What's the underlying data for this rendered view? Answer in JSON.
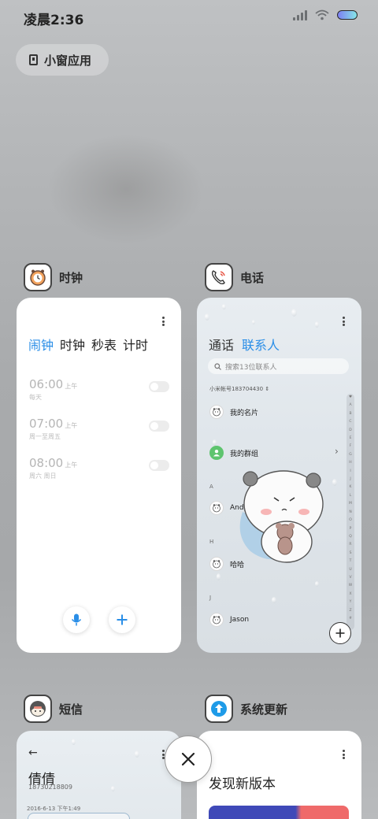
{
  "status_bar": {
    "time": "凌晨2:36"
  },
  "floating_windows": {
    "label": "小窗应用"
  },
  "apps": {
    "clock": {
      "name": "时钟",
      "tabs": [
        "闹钟",
        "时钟",
        "秒表",
        "计时"
      ],
      "alarms": [
        {
          "time": "06:00",
          "ampm": "上午",
          "days": "每天"
        },
        {
          "time": "07:00",
          "ampm": "上午",
          "days": "周一至周五"
        },
        {
          "time": "08:00",
          "ampm": "上午",
          "days": "周六 周日"
        }
      ]
    },
    "phone": {
      "name": "电话",
      "tabs": [
        "通话",
        "联系人"
      ],
      "search_placeholder": "搜索13位联系人",
      "account": "小米帐号183704430",
      "contacts": [
        {
          "name": "我的名片"
        },
        {
          "name": "我的群组"
        },
        {
          "name": "Andy"
        },
        {
          "name": "哈哈"
        },
        {
          "name": "Jason"
        }
      ],
      "sections": [
        "A",
        "H",
        "J"
      ],
      "index_letters": [
        "♥",
        "A",
        "B",
        "C",
        "D",
        "E",
        "F",
        "G",
        "H",
        "I",
        "J",
        "K",
        "L",
        "M",
        "N",
        "O",
        "P",
        "Q",
        "R",
        "S",
        "T",
        "U",
        "V",
        "W",
        "X",
        "Y",
        "Z",
        "#"
      ]
    },
    "sms": {
      "name": "短信",
      "contact_name": "倩倩",
      "contact_number": "18730218809",
      "date": "2016-6-13 下午1:49"
    },
    "update": {
      "name": "系统更新",
      "title": "发现新版本"
    }
  },
  "colors": {
    "accent_blue": "#2a8ee7",
    "group_green": "#5ec46e",
    "banner_blue": "#3f49b8",
    "banner_red": "#ef6a6a"
  }
}
